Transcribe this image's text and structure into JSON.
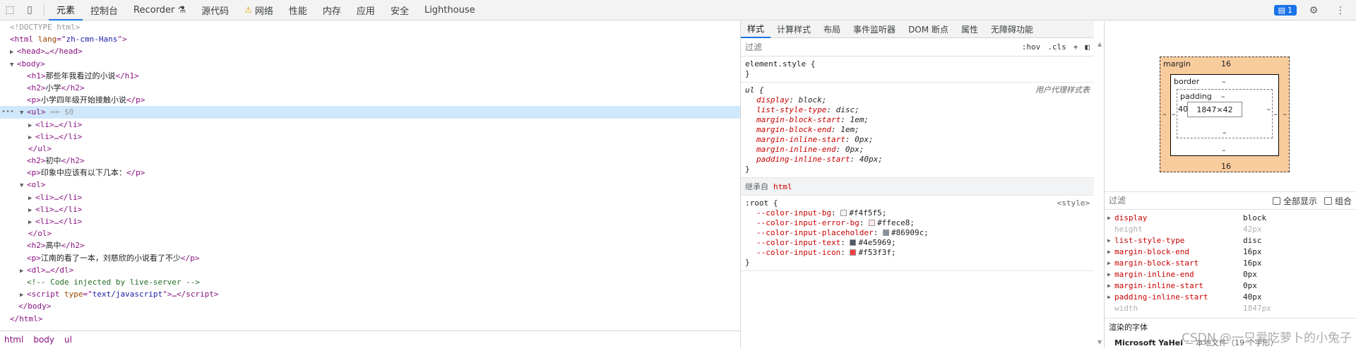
{
  "tabs": [
    "元素",
    "控制台",
    "Recorder",
    "源代码",
    "网络",
    "性能",
    "内存",
    "应用",
    "安全",
    "Lighthouse"
  ],
  "issues_count": "1",
  "dom": {
    "doctype": "<!DOCTYPE html>",
    "html_lang": "zh-cmn-Hans",
    "h1_text": "那些年我看过的小说",
    "h2_1": "小学",
    "p_1": "小学四年级开始接触小说",
    "sel_marker": "== $0",
    "h2_2": "初中",
    "p_2": "印象中应该有以下几本：",
    "h2_3": "高中",
    "p_3": "江南的看了一本，刘慈欣的小说看了不少",
    "comment": "<!-- Code injected by live-server -->",
    "script_type": "text/javascript"
  },
  "breadcrumbs": [
    "html",
    "body",
    "ul"
  ],
  "styles_tabs": [
    "样式",
    "计算样式",
    "布局",
    "事件监听器",
    "DOM 断点",
    "属性",
    "无障碍功能"
  ],
  "styles": {
    "filter_placeholder": "过滤",
    "hov": ":hov",
    "cls": ".cls",
    "element_style": "element.style {",
    "ua_selector": "ul {",
    "ua_label": "用户代理样式表",
    "ua_props": [
      {
        "name": "display",
        "value": "block;"
      },
      {
        "name": "list-style-type",
        "value": "disc;"
      },
      {
        "name": "margin-block-start",
        "value": "1em;"
      },
      {
        "name": "margin-block-end",
        "value": "1em;"
      },
      {
        "name": "margin-inline-start",
        "value": "0px;"
      },
      {
        "name": "margin-inline-end",
        "value": "0px;"
      },
      {
        "name": "padding-inline-start",
        "value": "40px;"
      }
    ],
    "inherited_label": "继承自",
    "inherited_tag": "html",
    "root_selector": ":root {",
    "root_source": "<style>",
    "vars": [
      {
        "name": "--color-input-bg",
        "value": "#f4f5f5;",
        "color": "#f4f5f5"
      },
      {
        "name": "--color-input-error-bg",
        "value": "#ffece8;",
        "color": "#ffece8"
      },
      {
        "name": "--color-input-placeholder",
        "value": "#86909c;",
        "color": "#86909c"
      },
      {
        "name": "--color-input-text",
        "value": "#4e5969;",
        "color": "#4e5969"
      },
      {
        "name": "--color-input-icon",
        "value": "#f53f3f;",
        "color": "#f53f3f"
      }
    ]
  },
  "boxmodel": {
    "margin_label": "margin",
    "margin_top": "16",
    "margin_bottom": "16",
    "margin_left": "–",
    "margin_right": "–",
    "border_label": "border",
    "border_top": "–",
    "border_bottom": "–",
    "border_left": "–",
    "border_right": "–",
    "padding_label": "padding",
    "padding_top": "–",
    "padding_bottom": "–",
    "padding_left": "40",
    "padding_right": "–",
    "content": "1847×42"
  },
  "computed": {
    "filter_placeholder": "过滤",
    "show_all": "全部显示",
    "group": "组合",
    "props": [
      {
        "name": "display",
        "value": "block",
        "dim": false,
        "expand": true
      },
      {
        "name": "height",
        "value": "42px",
        "dim": true,
        "expand": false
      },
      {
        "name": "list-style-type",
        "value": "disc",
        "dim": false,
        "expand": true
      },
      {
        "name": "margin-block-end",
        "value": "16px",
        "dim": false,
        "expand": true
      },
      {
        "name": "margin-block-start",
        "value": "16px",
        "dim": false,
        "expand": true
      },
      {
        "name": "margin-inline-end",
        "value": "0px",
        "dim": false,
        "expand": true
      },
      {
        "name": "margin-inline-start",
        "value": "0px",
        "dim": false,
        "expand": true
      },
      {
        "name": "padding-inline-start",
        "value": "40px",
        "dim": false,
        "expand": true
      },
      {
        "name": "width",
        "value": "1847px",
        "dim": true,
        "expand": false
      }
    ],
    "fonts_title": "渲染的字体",
    "font_name": "Microsoft YaHei",
    "font_source": "— 本地文件（19 个字形）"
  },
  "watermark": "CSDN @一只爱吃萝卜的小兔子"
}
